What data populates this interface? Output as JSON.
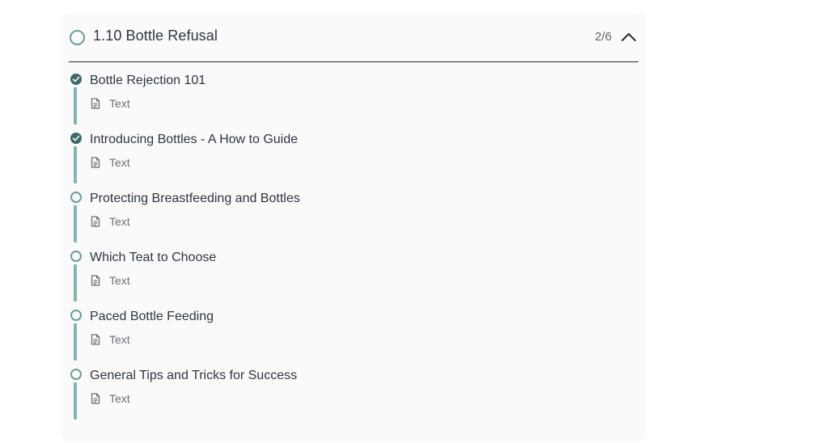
{
  "module": {
    "title": "1.10 Bottle Refusal",
    "progress": "2/6",
    "expanded": true
  },
  "lessons": [
    {
      "title": "Bottle Rejection 101",
      "type": "Text",
      "completed": true
    },
    {
      "title": "Introducing Bottles - A How to Guide",
      "type": "Text",
      "completed": true
    },
    {
      "title": "Protecting Breastfeeding and Bottles",
      "type": "Text",
      "completed": false
    },
    {
      "title": "Which Teat to Choose",
      "type": "Text",
      "completed": false
    },
    {
      "title": "Paced Bottle Feeding",
      "type": "Text",
      "completed": false
    },
    {
      "title": "General Tips and Tricks for Success",
      "type": "Text",
      "completed": false
    }
  ],
  "colors": {
    "accent": "#6e9ea0",
    "rail": "#86b3b3",
    "done": "#3e6a6a"
  },
  "icons": {
    "header": "circle-icon",
    "collapse": "chevron-up-icon",
    "completed": "check-circle-icon",
    "incomplete": "circle-outline-icon",
    "type": "document-icon"
  }
}
